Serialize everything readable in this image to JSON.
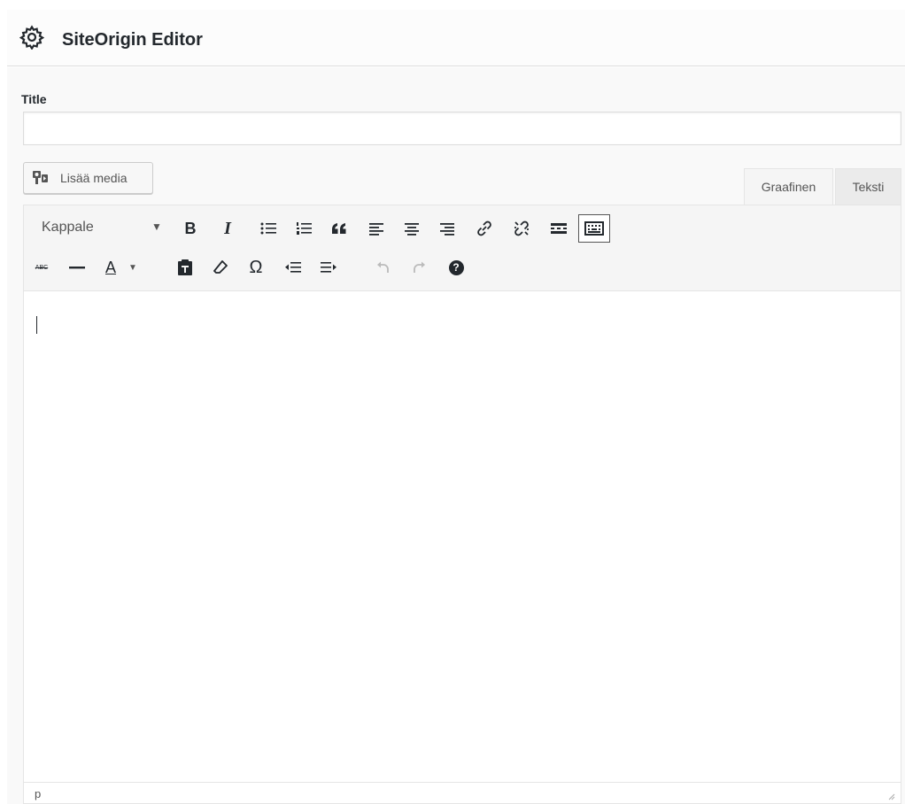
{
  "header": {
    "title": "SiteOrigin Editor",
    "icon": "gear-icon"
  },
  "form": {
    "title_label": "Title",
    "title_value": "",
    "title_placeholder": ""
  },
  "media_button": {
    "label": "Lisää media",
    "icon": "media-icon"
  },
  "tabs": [
    {
      "label": "Graafinen",
      "active": true
    },
    {
      "label": "Teksti",
      "active": false
    }
  ],
  "toolbar": {
    "format_select": "Kappale",
    "row1": [
      "bold",
      "italic",
      "bullet-list",
      "numbered-list",
      "blockquote",
      "align-left",
      "align-center",
      "align-right",
      "insert-link",
      "remove-link",
      "read-more",
      "toolbar-toggle"
    ],
    "row2": [
      "strikethrough",
      "horizontal-line",
      "text-color",
      "paste-as-text",
      "clear-formatting",
      "special-character",
      "outdent",
      "indent",
      "undo",
      "redo",
      "keyboard-shortcuts"
    ],
    "bold_glyph": "B",
    "italic_glyph": "I",
    "strike_glyph": "ABC",
    "text_color_glyph": "A",
    "omega_glyph": "Ω",
    "help_glyph": "?"
  },
  "statusbar": {
    "path": "p"
  },
  "colors": {
    "accent": "#23282d",
    "panel_bg": "#f9f9f9",
    "toolbar_bg": "#f5f5f5"
  }
}
